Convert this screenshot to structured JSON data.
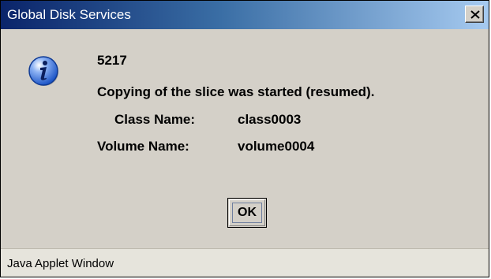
{
  "window": {
    "title": "Global Disk Services",
    "close_symbol": "×"
  },
  "message": {
    "icon": "info-icon",
    "code": "5217",
    "text": "Copying of the slice was started (resumed).",
    "class_label": "Class Name:",
    "class_value": "class0003",
    "volume_label": "Volume Name:",
    "volume_value": "volume0004"
  },
  "buttons": {
    "ok_label": "OK"
  },
  "status_bar": {
    "text": "Java Applet Window"
  },
  "colors": {
    "titlebar_start": "#0a246a",
    "titlebar_end": "#a6caf0",
    "dialog_bg": "#d4d0c8",
    "icon_blue": "#1f57c8"
  }
}
